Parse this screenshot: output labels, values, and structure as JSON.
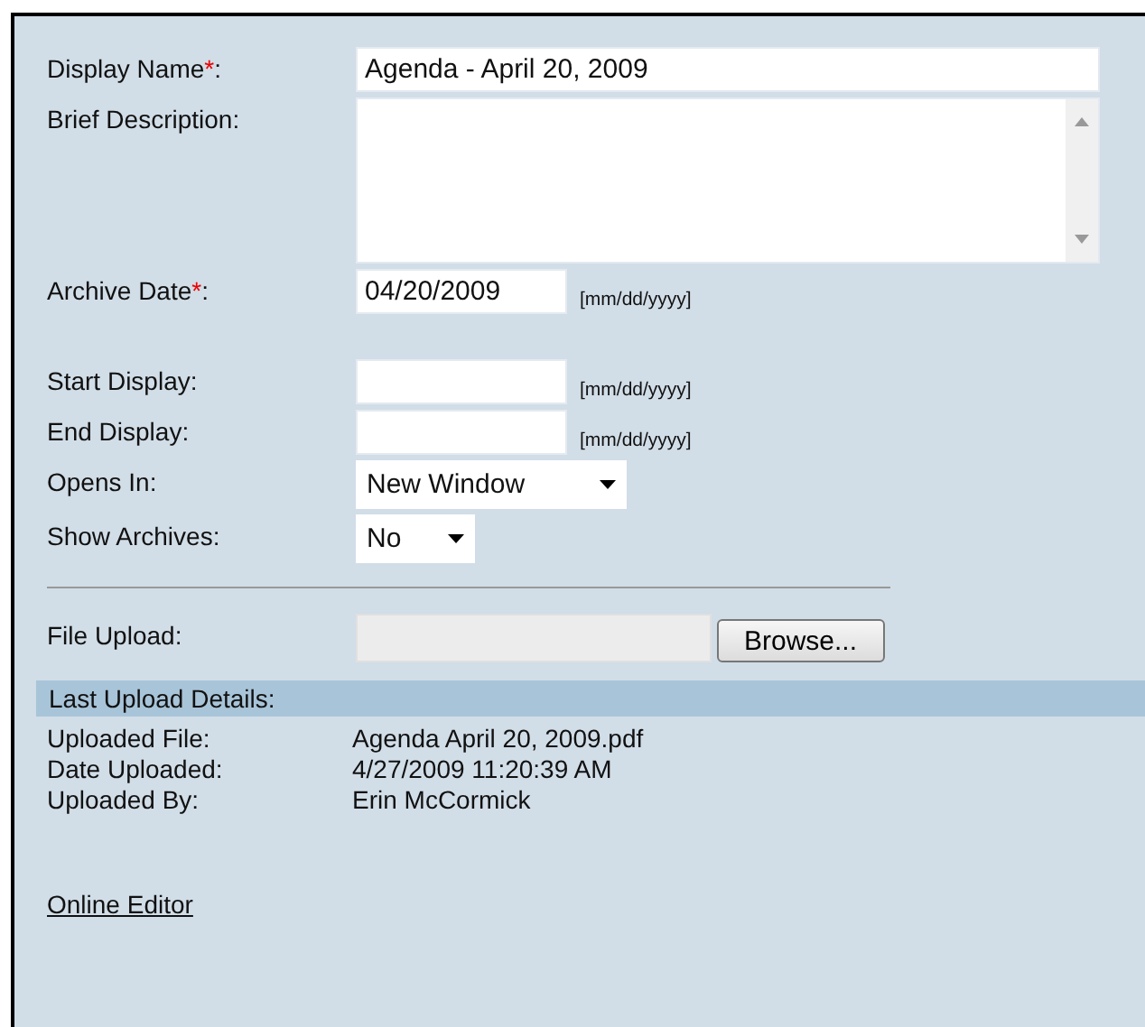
{
  "form": {
    "fields": [
      {
        "kind": "text",
        "label": "Display Name",
        "required_mark": "*",
        "colon": ":",
        "value": "Agenda - April 20, 2009"
      },
      {
        "kind": "textarea",
        "label": "Brief Description:"
      },
      {
        "kind": "date",
        "label": "Archive Date",
        "required_mark": "*",
        "colon": ":",
        "value": "04/20/2009",
        "hint": "[mm/dd/yyyy]"
      },
      {
        "kind": "date",
        "label": "Start Display:",
        "hint": "[mm/dd/yyyy]"
      },
      {
        "kind": "date",
        "label": "End Display:",
        "hint": "[mm/dd/yyyy]"
      },
      {
        "kind": "select",
        "label": "Opens In:",
        "value": "New Window"
      },
      {
        "kind": "select",
        "label": "Show Archives:",
        "value": "No"
      },
      {
        "kind": "file",
        "label": "File Upload:",
        "button": "Browse..."
      }
    ]
  },
  "last_upload": {
    "title": "Last Upload Details:",
    "rows": [
      {
        "label": "Uploaded File:",
        "value": "Agenda April 20, 2009.pdf"
      },
      {
        "label": "Date Uploaded:",
        "value": "4/27/2009 11:20:39 AM"
      },
      {
        "label": "Uploaded By:",
        "value": "Erin McCormick"
      }
    ]
  },
  "link": "Online Editor"
}
